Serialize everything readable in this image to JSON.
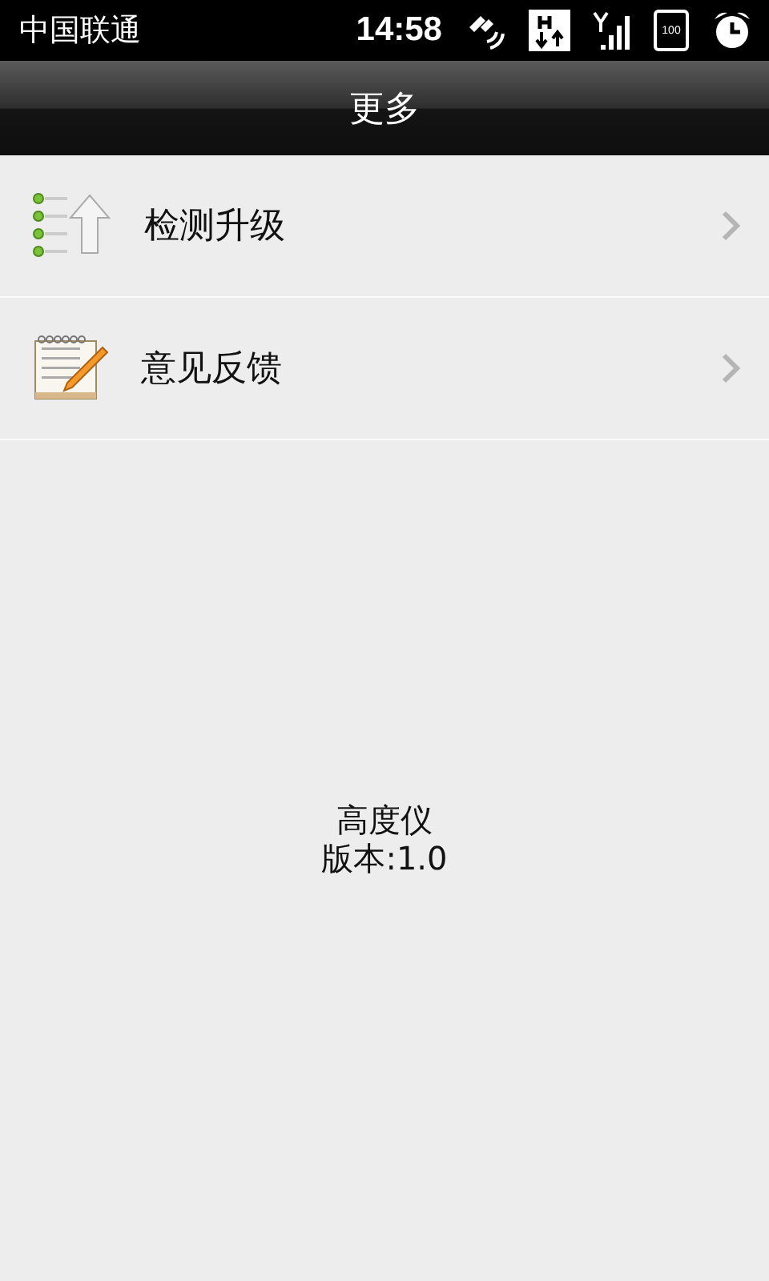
{
  "status_bar": {
    "carrier": "中国联通",
    "time": "14:58",
    "battery": "100"
  },
  "title_bar": {
    "title": "更多"
  },
  "menu": [
    {
      "kind": "update",
      "label": "检测升级"
    },
    {
      "kind": "feedback",
      "label": "意见反馈"
    }
  ],
  "about": {
    "app_name": "高度仪",
    "version": "版本:1.0"
  }
}
